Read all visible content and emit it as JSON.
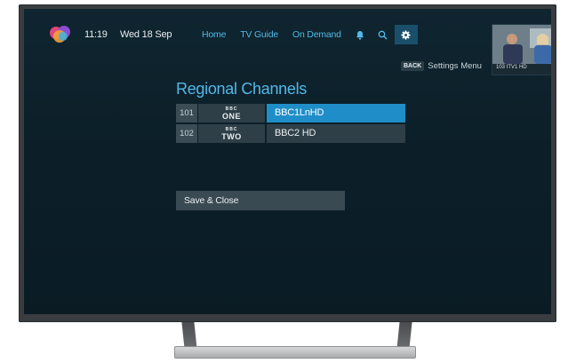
{
  "status_bar": {
    "time": "11:19",
    "date": "Wed 18 Sep"
  },
  "nav": {
    "items": [
      {
        "label": "Home"
      },
      {
        "label": "TV Guide"
      },
      {
        "label": "On Demand"
      }
    ],
    "icons": [
      "bell-icon",
      "search-icon",
      "gear-icon"
    ],
    "active_icon": "gear-icon"
  },
  "preview": {
    "label": "103 ITV1 HD"
  },
  "back_hint": {
    "key": "BACK",
    "text": "Settings Menu"
  },
  "page": {
    "title": "Regional Channels"
  },
  "channels": [
    {
      "number": "101",
      "logo_top": "BBC",
      "logo_name": "ONE",
      "selected": "BBC1LnHD",
      "focused": true
    },
    {
      "number": "102",
      "logo_top": "BBC",
      "logo_name": "TWO",
      "selected": "BBC2 HD",
      "focused": false
    }
  ],
  "actions": {
    "save_label": "Save & Close"
  },
  "colors": {
    "accent": "#52b8e8",
    "focus": "#1f8ec8",
    "background": "#0c1f29"
  }
}
